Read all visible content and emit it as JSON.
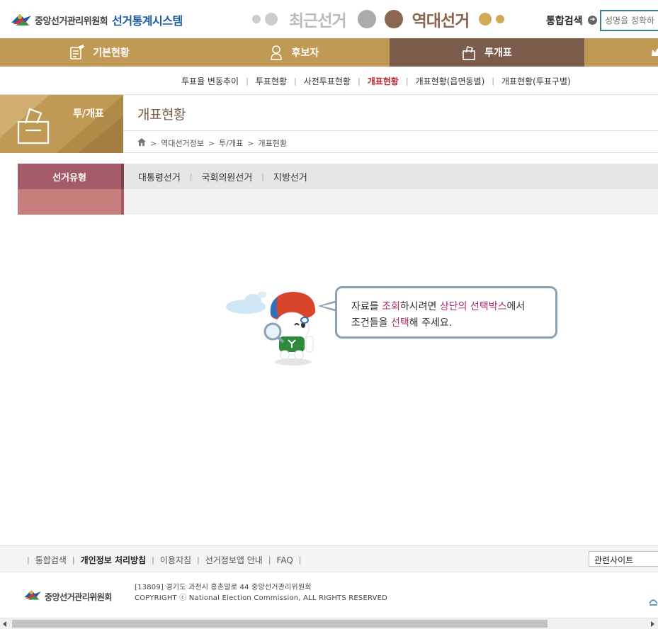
{
  "header": {
    "org_name": "중앙선거관리위원회",
    "system_name": "선거통계시스템",
    "recent_election": "최근선거",
    "past_election": "역대선거",
    "search_label": "통합검색",
    "search_placeholder": "성명을 정확하"
  },
  "colors": {
    "gold": "#c09a55",
    "brown": "#7b5b49",
    "rose": "#a45a68",
    "highlight": "#b12a6b",
    "logo_blue": "#1e5aa8"
  },
  "main_nav": {
    "items": [
      {
        "label": "기본현황",
        "icon": "checklist-icon"
      },
      {
        "label": "후보자",
        "icon": "person-icon"
      },
      {
        "label": "투개표",
        "icon": "ballot-box-icon",
        "active": true
      },
      {
        "label": "",
        "icon": "crown-icon"
      }
    ]
  },
  "sub_nav": {
    "items": [
      {
        "label": "투표율 변동추이"
      },
      {
        "label": "투표현황"
      },
      {
        "label": "사전투표현황"
      },
      {
        "label": "개표현황",
        "active": true
      },
      {
        "label": "개표현황(읍면동별)"
      },
      {
        "label": "개표현황(투표구별)"
      }
    ]
  },
  "section": {
    "tile_label": "투/개표",
    "page_title": "개표현황",
    "breadcrumb": [
      "역대선거정보",
      "투/개표",
      "개표현황"
    ]
  },
  "filter": {
    "label": "선거유형",
    "options": [
      "대통령선거",
      "국회의원선거",
      "지방선거"
    ]
  },
  "message": {
    "line1": [
      "자료를 ",
      "조회",
      "하시려면 ",
      "상단의 선택박스",
      "에서"
    ],
    "line2": [
      "조건들을 ",
      "선택",
      "해 주세요."
    ]
  },
  "footer": {
    "links": [
      "통합검색",
      "개인정보 처리방침",
      "이용지침",
      "선거정보앱 안내",
      "FAQ"
    ],
    "related_sites": "관련사이트",
    "org_name": "중앙선거관리위원회",
    "address": "[13809] 경기도 과천시 홍촌말로 44 중앙선거관리위원회",
    "copyright": "COPYRIGHT ⓒ National Election Commission, ALL RIGHTS RESERVED"
  }
}
